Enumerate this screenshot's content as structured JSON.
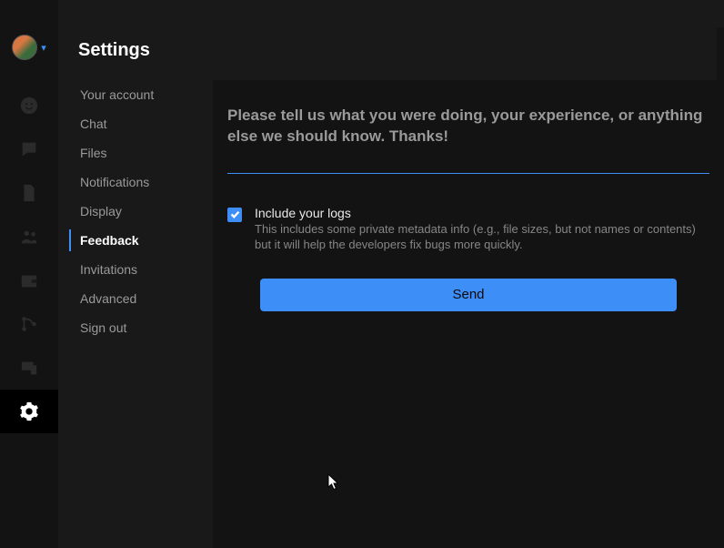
{
  "window": {
    "title": "Settings"
  },
  "subnav": {
    "items": [
      {
        "label": "Your account"
      },
      {
        "label": "Chat"
      },
      {
        "label": "Files"
      },
      {
        "label": "Notifications"
      },
      {
        "label": "Display"
      },
      {
        "label": "Feedback"
      },
      {
        "label": "Invitations"
      },
      {
        "label": "Advanced"
      },
      {
        "label": "Sign out"
      }
    ],
    "active_index": 5
  },
  "feedback": {
    "placeholder": "Please tell us what you were doing, your experience, or anything else we should know. Thanks!",
    "include_logs_label": "Include your logs",
    "include_logs_desc": "This includes some private metadata info (e.g., file sizes, but not names or contents) but it will help the developers fix bugs more quickly.",
    "include_logs_checked": true,
    "send_label": "Send"
  },
  "rail": {
    "icons": [
      "people-icon",
      "chat-icon",
      "files-icon",
      "team-icon",
      "wallet-icon",
      "git-icon",
      "devices-icon",
      "gear-icon"
    ],
    "active_index": 7
  },
  "colors": {
    "accent": "#3e8ef7",
    "bg_dark": "#131313",
    "bg_panel": "#191919",
    "text_muted": "#9a9a9a"
  }
}
